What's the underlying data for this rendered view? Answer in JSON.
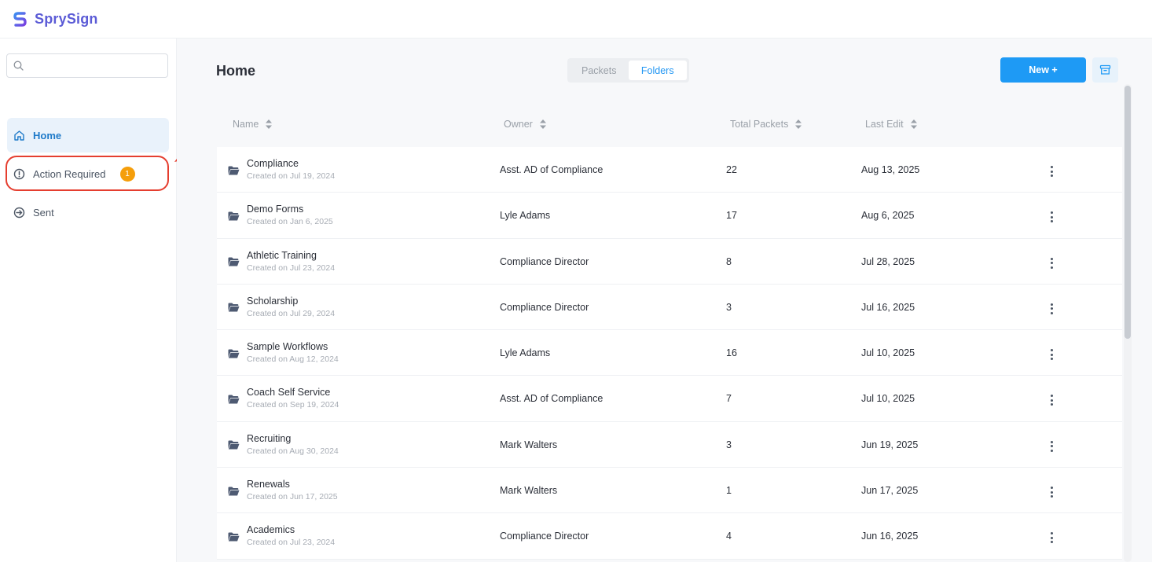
{
  "app": {
    "name": "SprySign",
    "brand_color": "#5b5bd6"
  },
  "sidebar": {
    "search": {
      "placeholder": "",
      "value": ""
    },
    "items": [
      {
        "label": "Home",
        "icon": "home-icon",
        "active": true
      },
      {
        "label": "Action Required",
        "icon": "alert-circle-icon",
        "badge": "1"
      },
      {
        "label": "Sent",
        "icon": "send-arrow-icon"
      }
    ]
  },
  "main": {
    "title": "Home",
    "toggle": {
      "options": [
        "Packets",
        "Folders"
      ],
      "selected": "Folders"
    },
    "new_button": "New +",
    "archive_icon": "archive-icon",
    "table": {
      "columns": [
        "Name",
        "Owner",
        "Total Packets",
        "Last Edit"
      ],
      "rows": [
        {
          "name": "Compliance",
          "created": "Created on Jul 19, 2024",
          "owner": "Asst. AD of Compliance",
          "total": "22",
          "last_edit": "Aug 13, 2025"
        },
        {
          "name": "Demo Forms",
          "created": "Created on Jan 6, 2025",
          "owner": "Lyle Adams",
          "total": "17",
          "last_edit": "Aug 6, 2025"
        },
        {
          "name": "Athletic Training",
          "created": "Created on Jul 23, 2024",
          "owner": "Compliance Director",
          "total": "8",
          "last_edit": "Jul 28, 2025"
        },
        {
          "name": "Scholarship",
          "created": "Created on Jul 29, 2024",
          "owner": "Compliance Director",
          "total": "3",
          "last_edit": "Jul 16, 2025"
        },
        {
          "name": "Sample Workflows",
          "created": "Created on Aug 12, 2024",
          "owner": "Lyle Adams",
          "total": "16",
          "last_edit": "Jul 10, 2025"
        },
        {
          "name": "Coach Self Service",
          "created": "Created on Sep 19, 2024",
          "owner": "Asst. AD of Compliance",
          "total": "7",
          "last_edit": "Jul 10, 2025"
        },
        {
          "name": "Recruiting",
          "created": "Created on Aug 30, 2024",
          "owner": "Mark Walters",
          "total": "3",
          "last_edit": "Jun 19, 2025"
        },
        {
          "name": "Renewals",
          "created": "Created on Jun 17, 2025",
          "owner": "Mark Walters",
          "total": "1",
          "last_edit": "Jun 17, 2025"
        },
        {
          "name": "Academics",
          "created": "Created on Jul 23, 2024",
          "owner": "Compliance Director",
          "total": "4",
          "last_edit": "Jun 16, 2025"
        }
      ]
    }
  },
  "colors": {
    "accent": "#1e9af5",
    "badge": "#f59e0b",
    "annotation": "#e53e2f"
  }
}
